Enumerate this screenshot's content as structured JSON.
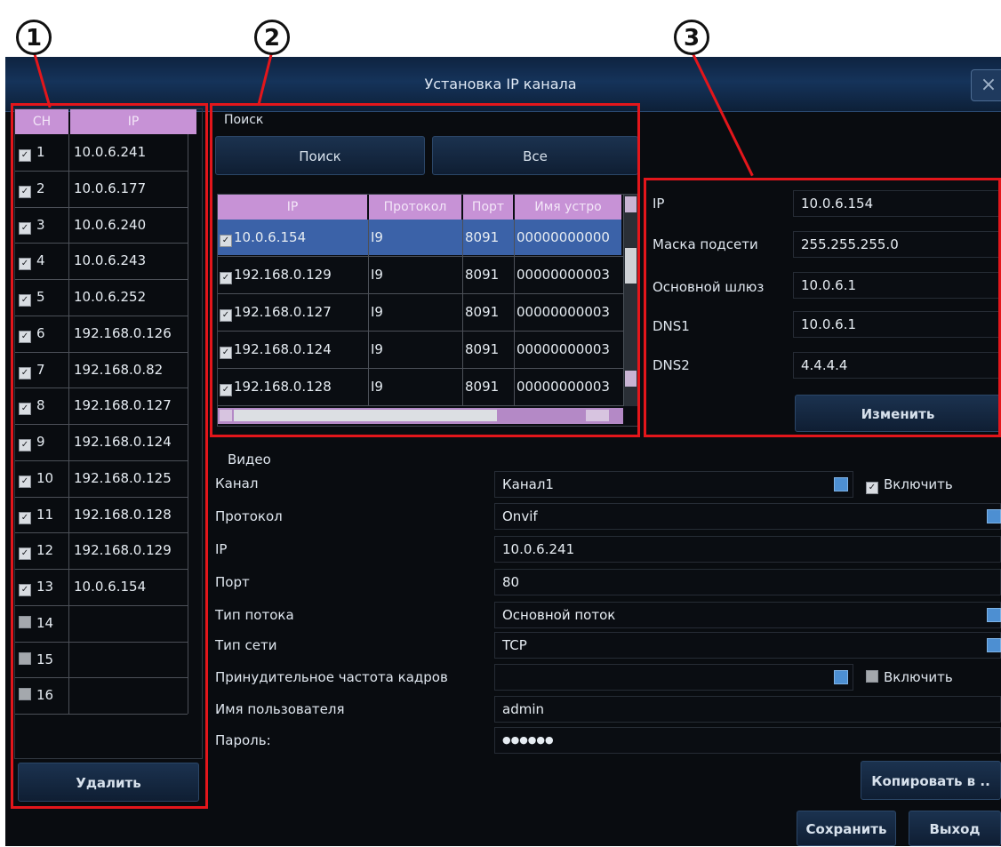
{
  "callouts": [
    "1",
    "2",
    "3"
  ],
  "window": {
    "title": "Установка IP канала",
    "close": "×"
  },
  "channels": {
    "headers": [
      "CH",
      "IP"
    ],
    "rows": [
      {
        "ch": "1",
        "ip": "10.0.6.241",
        "checked": true
      },
      {
        "ch": "2",
        "ip": "10.0.6.177",
        "checked": true
      },
      {
        "ch": "3",
        "ip": "10.0.6.240",
        "checked": true
      },
      {
        "ch": "4",
        "ip": "10.0.6.243",
        "checked": true
      },
      {
        "ch": "5",
        "ip": "10.0.6.252",
        "checked": true
      },
      {
        "ch": "6",
        "ip": "192.168.0.126",
        "checked": true
      },
      {
        "ch": "7",
        "ip": "192.168.0.82",
        "checked": true
      },
      {
        "ch": "8",
        "ip": "192.168.0.127",
        "checked": true
      },
      {
        "ch": "9",
        "ip": "192.168.0.124",
        "checked": true
      },
      {
        "ch": "10",
        "ip": "192.168.0.125",
        "checked": true
      },
      {
        "ch": "11",
        "ip": "192.168.0.128",
        "checked": true
      },
      {
        "ch": "12",
        "ip": "192.168.0.129",
        "checked": true
      },
      {
        "ch": "13",
        "ip": "10.0.6.154",
        "checked": true
      },
      {
        "ch": "14",
        "ip": "",
        "checked": false
      },
      {
        "ch": "15",
        "ip": "",
        "checked": false
      },
      {
        "ch": "16",
        "ip": "",
        "checked": false
      }
    ],
    "delete_label": "Удалить"
  },
  "search": {
    "section_label": "Поиск",
    "search_button": "Поиск",
    "all_button": "Все",
    "headers": [
      "IP",
      "Протокол",
      "Порт",
      "Имя устро"
    ],
    "rows": [
      {
        "ip": "10.0.6.154",
        "protocol": "I9",
        "port": "8091",
        "name": "00000000000"
      },
      {
        "ip": "192.168.0.129",
        "protocol": "I9",
        "port": "8091",
        "name": "00000000003"
      },
      {
        "ip": "192.168.0.127",
        "protocol": "I9",
        "port": "8091",
        "name": "00000000003"
      },
      {
        "ip": "192.168.0.124",
        "protocol": "I9",
        "port": "8091",
        "name": "00000000003"
      },
      {
        "ip": "192.168.0.128",
        "protocol": "I9",
        "port": "8091",
        "name": "00000000003"
      }
    ]
  },
  "network": {
    "ip_label": "IP",
    "ip": "10.0.6.154",
    "mask_label": "Маска подсети",
    "mask": "255.255.255.0",
    "gateway_label": "Основной шлюз",
    "gateway": "10.0.6.1",
    "dns1_label": "DNS1",
    "dns1": "10.0.6.1",
    "dns2_label": "DNS2",
    "dns2": "4.4.4.4",
    "change_button": "Изменить"
  },
  "video": {
    "section_label": "Видео",
    "channel_label": "Канал",
    "channel": "Канал1",
    "enable_label": "Включить",
    "protocol_label": "Протокол",
    "protocol": "Onvif",
    "ip_label": "IP",
    "ip": "10.0.6.241",
    "port_label": "Порт",
    "port": "80",
    "stream_label": "Тип потока",
    "stream": "Основной поток",
    "nettype_label": "Тип сети",
    "nettype": "TCP",
    "framerate_label": "Принудительное частота кадров",
    "framerate": "",
    "framerate_enable_label": "Включить",
    "user_label": "Имя пользователя",
    "user": "admin",
    "password_label": "Пароль:",
    "password": "●●●●●●"
  },
  "buttons": {
    "copy": "Копировать в ..",
    "save": "Сохранить",
    "exit": "Выход"
  },
  "colors": {
    "annotation_red": "#e3161b",
    "header_purple": "#c792d6",
    "selection_blue": "#3b62a8",
    "title_bar": "#15335a"
  }
}
